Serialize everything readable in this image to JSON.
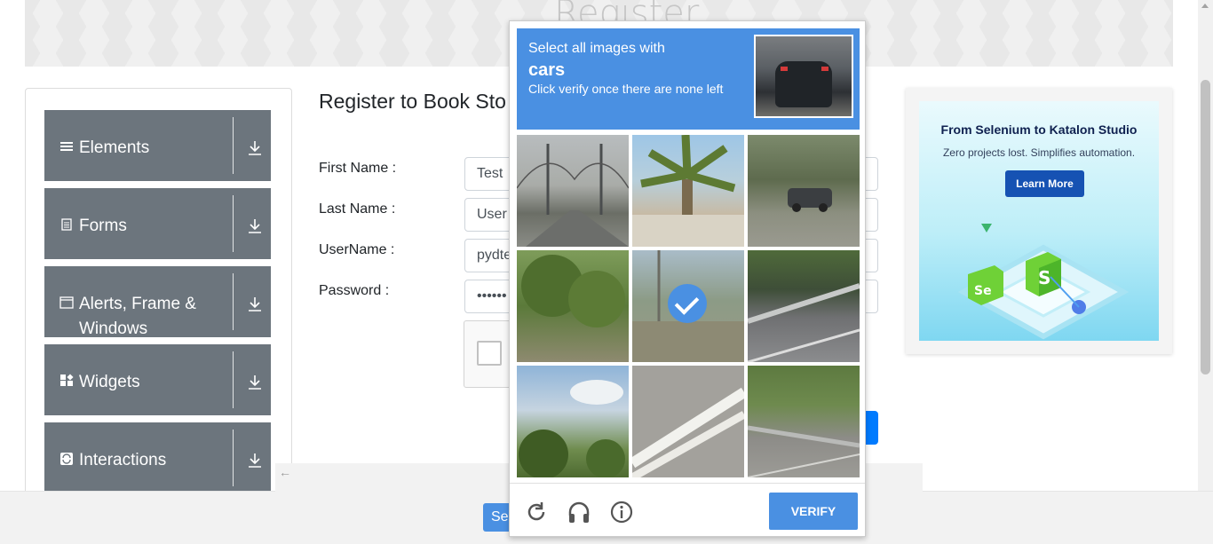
{
  "header": {
    "title": "Register"
  },
  "sidebar": {
    "groups": [
      {
        "label": "Elements",
        "icon": "hamburger-icon"
      },
      {
        "label": "Forms",
        "icon": "document-icon"
      },
      {
        "label": "Alerts, Frame & Windows",
        "icon": "window-icon"
      },
      {
        "label": "Widgets",
        "icon": "widgets-icon"
      },
      {
        "label": "Interactions",
        "icon": "refresh-square-icon"
      }
    ]
  },
  "form": {
    "title": "Register to Book Sto",
    "first_name_label": "First Name :",
    "first_name_value": "Test",
    "last_name_label": "Last Name :",
    "last_name_value": "User",
    "username_label": "UserName :",
    "username_value": "pydte",
    "password_label": "Password :",
    "password_value": "••••••"
  },
  "ad": {
    "title": "From Selenium to Katalon Studio",
    "subtitle": "Zero projects lost. Simplifies automation.",
    "button": "Learn More"
  },
  "captcha": {
    "line1": "Select all images with",
    "target": "cars",
    "line3": "Click verify once there are none left",
    "verify_label": "VERIFY",
    "selected_tile": 4
  },
  "bottom": {
    "submit_partial": "Se"
  },
  "colors": {
    "sidebar_group": "#6c757d",
    "captcha_blue": "#4a90e2",
    "primary": "#007bff"
  }
}
